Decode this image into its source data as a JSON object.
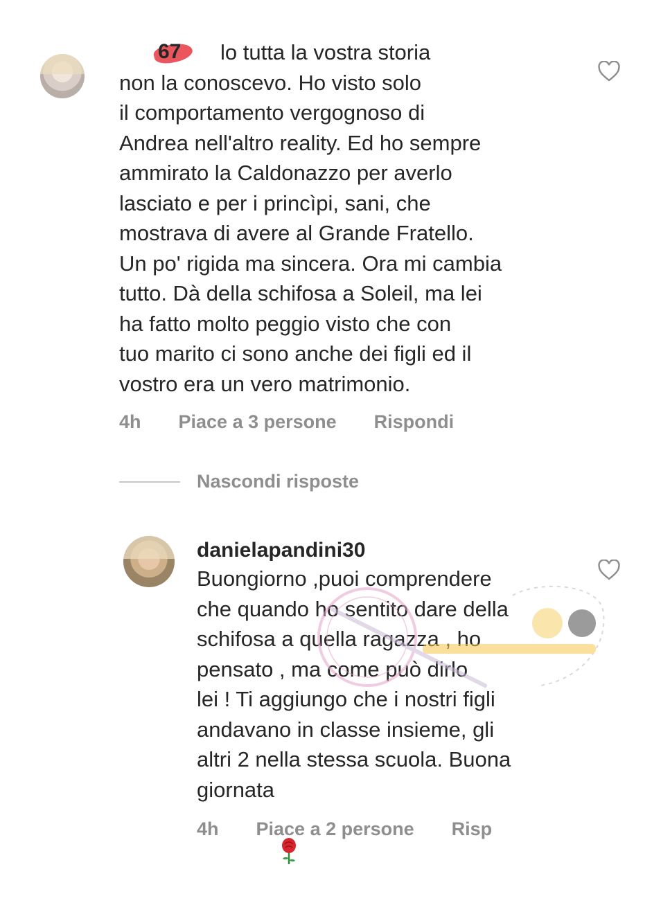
{
  "comments": [
    {
      "username": "67",
      "text": "lo tutta la vostra storia\nnon la conoscevo. Ho visto solo\nil comportamento vergognoso di\nAndrea nell'altro reality. Ed ho sempre\nammirato la Caldonazzo per averlo\nlasciato e per i princìpi, sani, che\nmostrava di avere al Grande Fratello.\nUn po' rigida ma sincera. Ora mi cambia\ntutto. Dà della schifosa a Soleil, ma lei\nha fatto molto peggio visto che con\ntuo marito ci sono anche dei figli ed il\nvostro era un vero matrimonio.",
      "time": "4h",
      "likes": "Piace a 3 persone",
      "reply": "Rispondi"
    },
    {
      "username": "danielapandini30",
      "text": "Buongiorno ,puoi comprendere\nche quando ho sentito dare della\nschifosa a quella ragazza , ho\npensato , ma come può dirlo\nlei ! Ti aggiungo che i nostri figli\nandavano in classe insieme, gli\naltri 2 nella stessa scuola. Buona\ngiornata",
      "time": "4h",
      "likes": "Piace a 2 persone",
      "reply": "Risp"
    }
  ],
  "hide_replies_label": "Nascondi risposte",
  "icons": {
    "like": "heart-outline-icon",
    "emoji": "rose-emoji"
  },
  "colors": {
    "text": "#262626",
    "meta": "#8e8e8e",
    "redaction": "#e8434c"
  }
}
